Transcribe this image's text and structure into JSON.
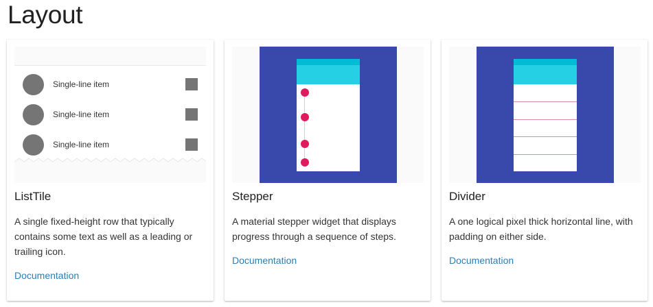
{
  "page": {
    "title": "Layout"
  },
  "colors": {
    "indigo": "#3949ab",
    "cyan": "#26d0e4",
    "pink": "#e01a5e",
    "link": "#2a7fb8",
    "grey_shape": "#757575"
  },
  "cards": [
    {
      "title": "ListTile",
      "description": "A single fixed-height row that typically contains some text as well as a leading or trailing icon.",
      "link": "Documentation",
      "thumbnail": {
        "type": "list-tile-illustration",
        "items": [
          {
            "label": "Single-line item"
          },
          {
            "label": "Single-line item"
          },
          {
            "label": "Single-line item"
          }
        ]
      }
    },
    {
      "title": "Stepper",
      "description": "A material stepper widget that displays progress through a sequence of steps.",
      "link": "Documentation",
      "thumbnail": {
        "type": "stepper-illustration",
        "step_count": 4
      }
    },
    {
      "title": "Divider",
      "description": "A one logical pixel thick horizontal line, with padding on either side.",
      "link": "Documentation",
      "thumbnail": {
        "type": "divider-illustration",
        "divider_count": 4
      }
    }
  ]
}
